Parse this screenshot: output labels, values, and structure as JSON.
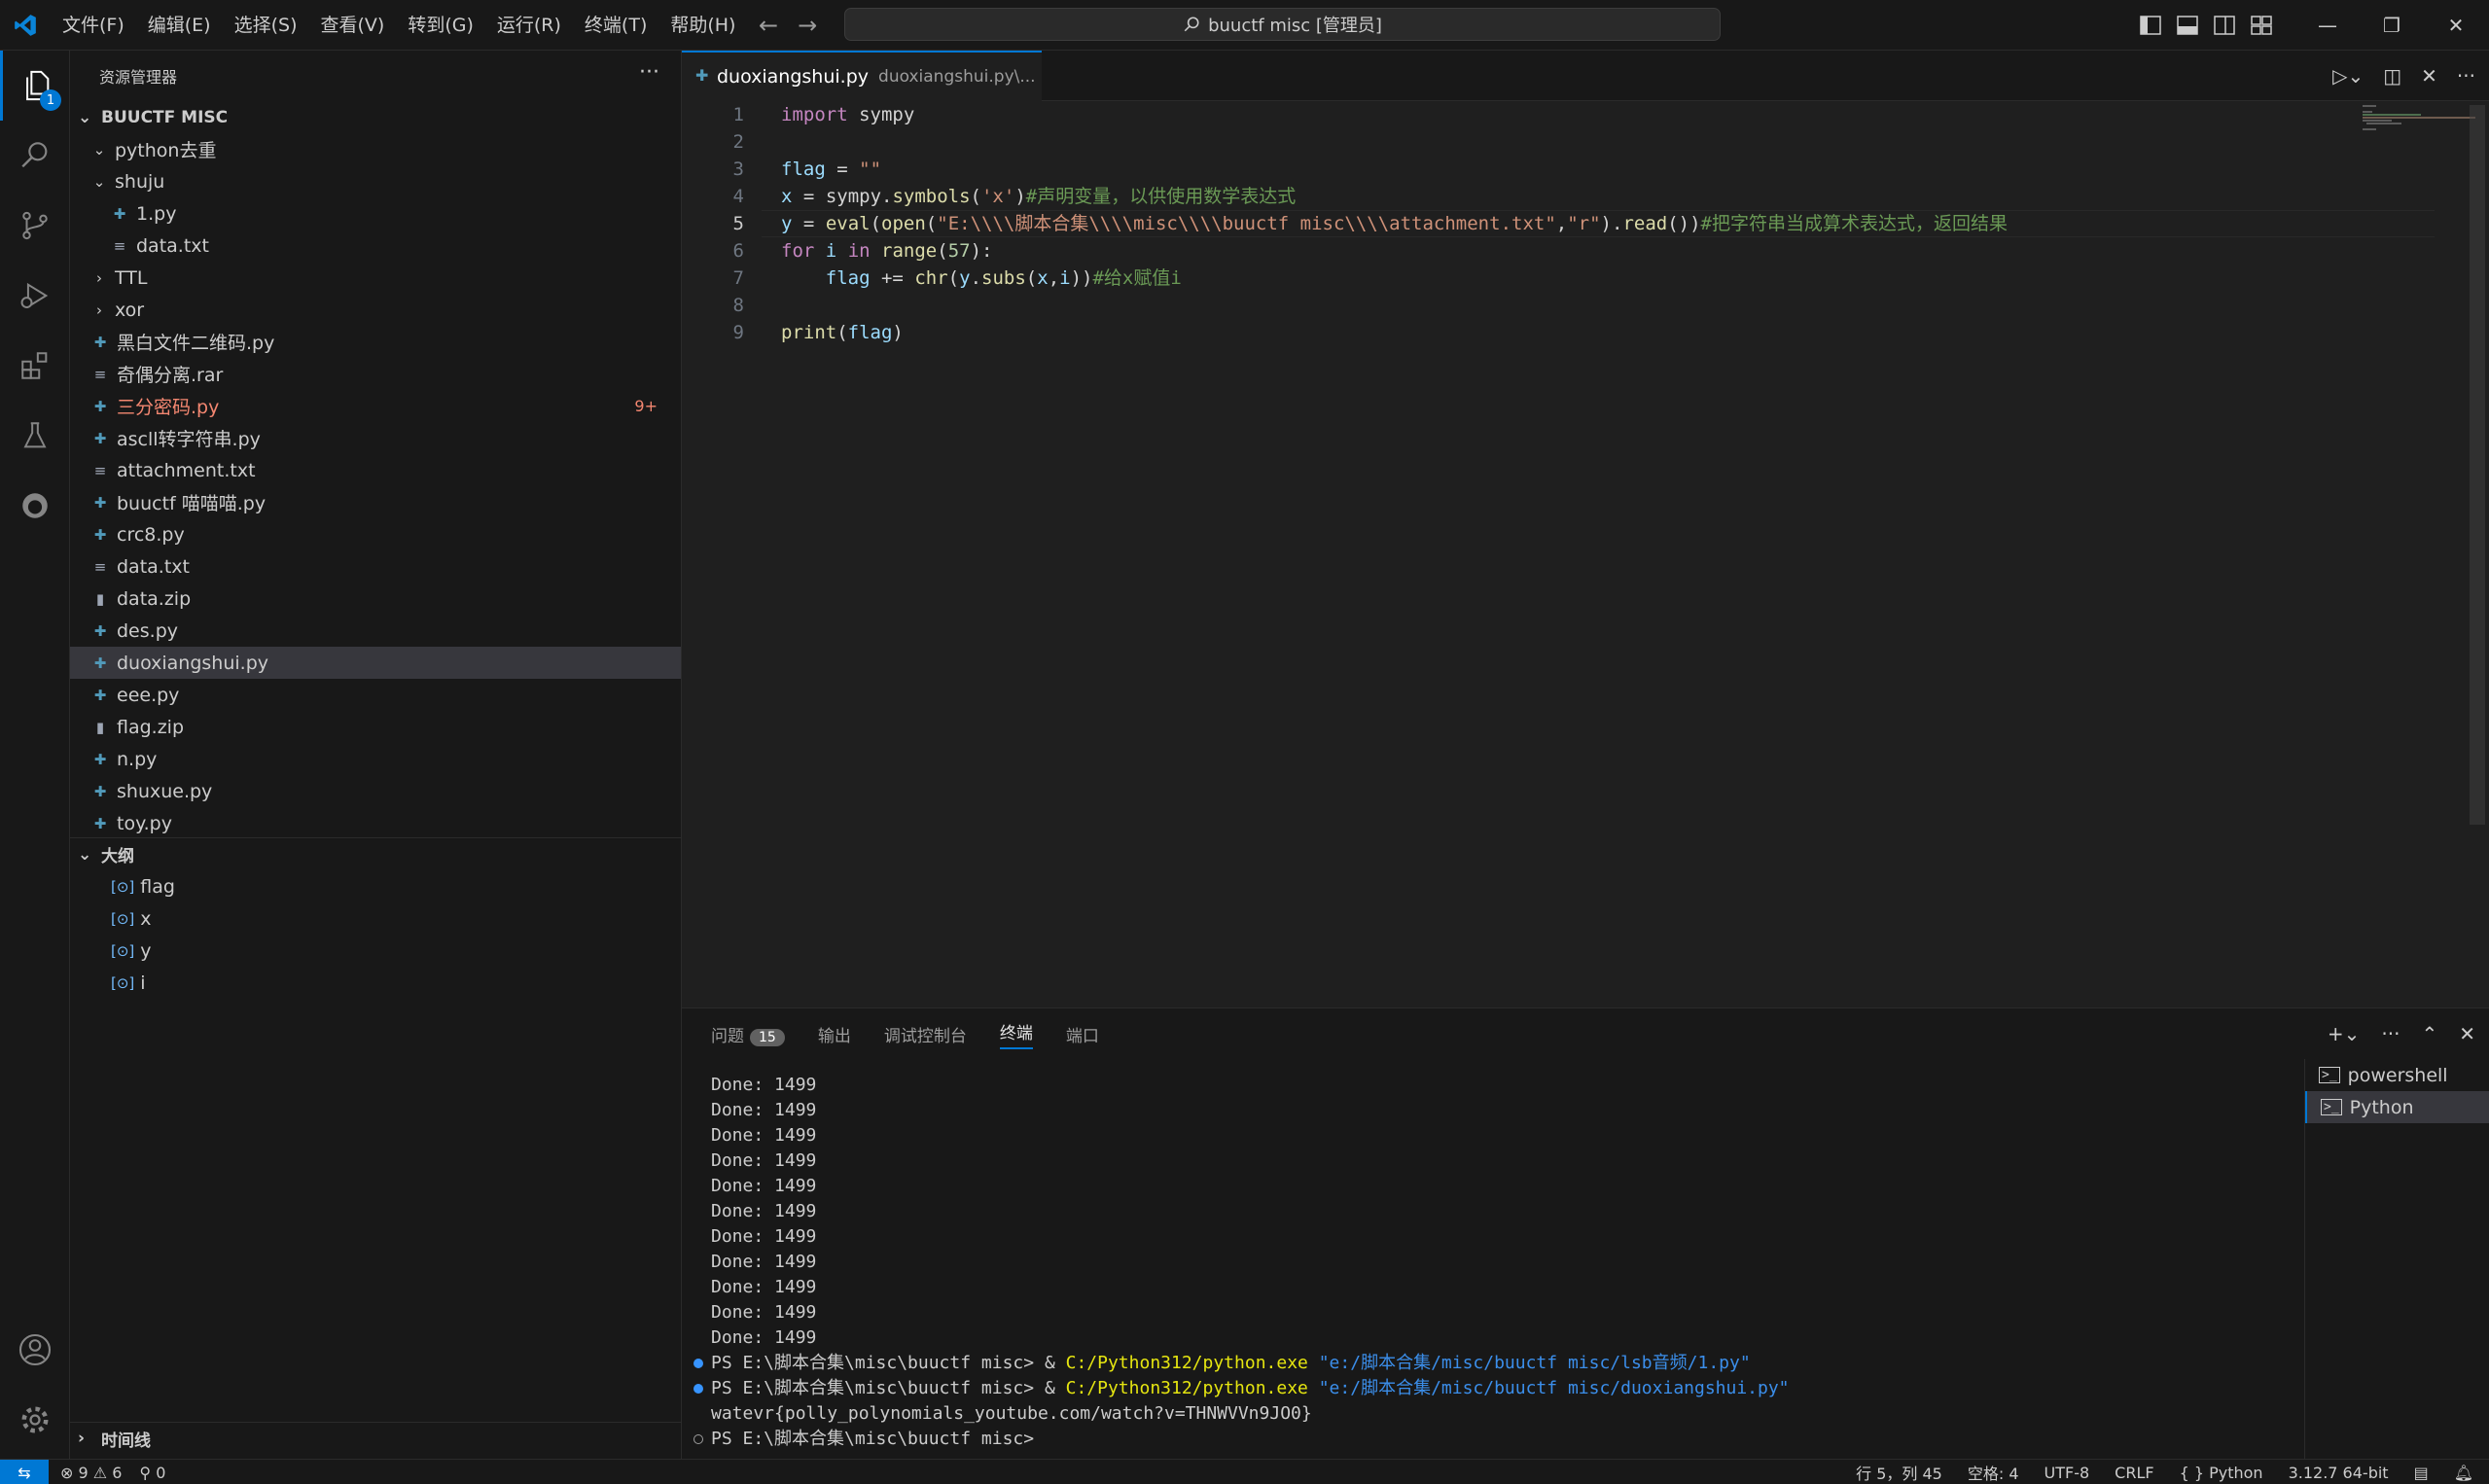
{
  "titlebar": {
    "menu": [
      "文件(F)",
      "编辑(E)",
      "选择(S)",
      "查看(V)",
      "转到(G)",
      "运行(R)",
      "终端(T)",
      "帮助(H)"
    ],
    "search_text": "buuctf misc [管理员]"
  },
  "activity": {
    "explorer_badge": "1"
  },
  "sidebar": {
    "header": "资源管理器",
    "root": "BUUCTF MISC",
    "items": [
      {
        "label": "python去重",
        "kind": "folder-open"
      },
      {
        "label": "shuju",
        "kind": "folder-open"
      },
      {
        "label": "1.py",
        "kind": "py"
      },
      {
        "label": "data.txt",
        "kind": "txt"
      },
      {
        "label": "TTL",
        "kind": "folder"
      },
      {
        "label": "xor",
        "kind": "folder"
      },
      {
        "label": "黑白文件二维码.py",
        "kind": "py"
      },
      {
        "label": "奇偶分离.rar",
        "kind": "txt"
      },
      {
        "label": "三分密码.py",
        "kind": "py-err",
        "count": "9+"
      },
      {
        "label": "ascll转字符串.py",
        "kind": "py"
      },
      {
        "label": "attachment.txt",
        "kind": "txt"
      },
      {
        "label": "buuctf 喵喵喵.py",
        "kind": "py"
      },
      {
        "label": "crc8.py",
        "kind": "py"
      },
      {
        "label": "data.txt",
        "kind": "txt"
      },
      {
        "label": "data.zip",
        "kind": "zip"
      },
      {
        "label": "des.py",
        "kind": "py"
      },
      {
        "label": "duoxiangshui.py",
        "kind": "py",
        "selected": true
      },
      {
        "label": "eee.py",
        "kind": "py"
      },
      {
        "label": "flag.zip",
        "kind": "zip"
      },
      {
        "label": "n.py",
        "kind": "py"
      },
      {
        "label": "shuxue.py",
        "kind": "py"
      },
      {
        "label": "toy.py",
        "kind": "py"
      }
    ],
    "outline_title": "大纲",
    "outline": [
      "flag",
      "x",
      "y",
      "i"
    ],
    "timeline_title": "时间线"
  },
  "editor": {
    "tab_name": "duoxiangshui.py",
    "tab_desc": "duoxiangshui.py\\...",
    "line_numbers": [
      "1",
      "2",
      "3",
      "4",
      "5",
      "6",
      "7",
      "8",
      "9"
    ],
    "current_line": "5"
  },
  "panel": {
    "tabs": [
      "问题",
      "输出",
      "调试控制台",
      "终端",
      "端口"
    ],
    "problems_count": "15",
    "terminal_lines": [
      "Done: 1499",
      "Done: 1499",
      "Done: 1499",
      "Done: 1499",
      "Done: 1499",
      "Done: 1499",
      "Done: 1499",
      "Done: 1499",
      "Done: 1499",
      "Done: 1499",
      "Done: 1499"
    ],
    "prompt": "PS E:\\脚本合集\\misc\\buuctf misc> ",
    "cmd1_exe": "C:/Python312/python.exe",
    "cmd1_arg": "\"e:/脚本合集/misc/buuctf misc/lsb音频/1.py\"",
    "cmd2_exe": "C:/Python312/python.exe",
    "cmd2_arg": "\"e:/脚本合集/misc/buuctf misc/duoxiangshui.py\"",
    "output": "watevr{polly_polynomials_youtube.com/watch?v=THNWVVn9JO0}",
    "final_prompt": "PS E:\\脚本合集\\misc\\buuctf misc>",
    "terminals": [
      "powershell",
      "Python"
    ]
  },
  "statusbar": {
    "errors": "9",
    "warnings": "6",
    "ports": "0",
    "position": "行 5，列 45",
    "spaces": "空格: 4",
    "encoding": "UTF-8",
    "eol": "CRLF",
    "language": "Python",
    "interpreter": "3.12.7 64-bit"
  },
  "colors": {
    "accent": "#0078d4",
    "error": "#f48771"
  }
}
